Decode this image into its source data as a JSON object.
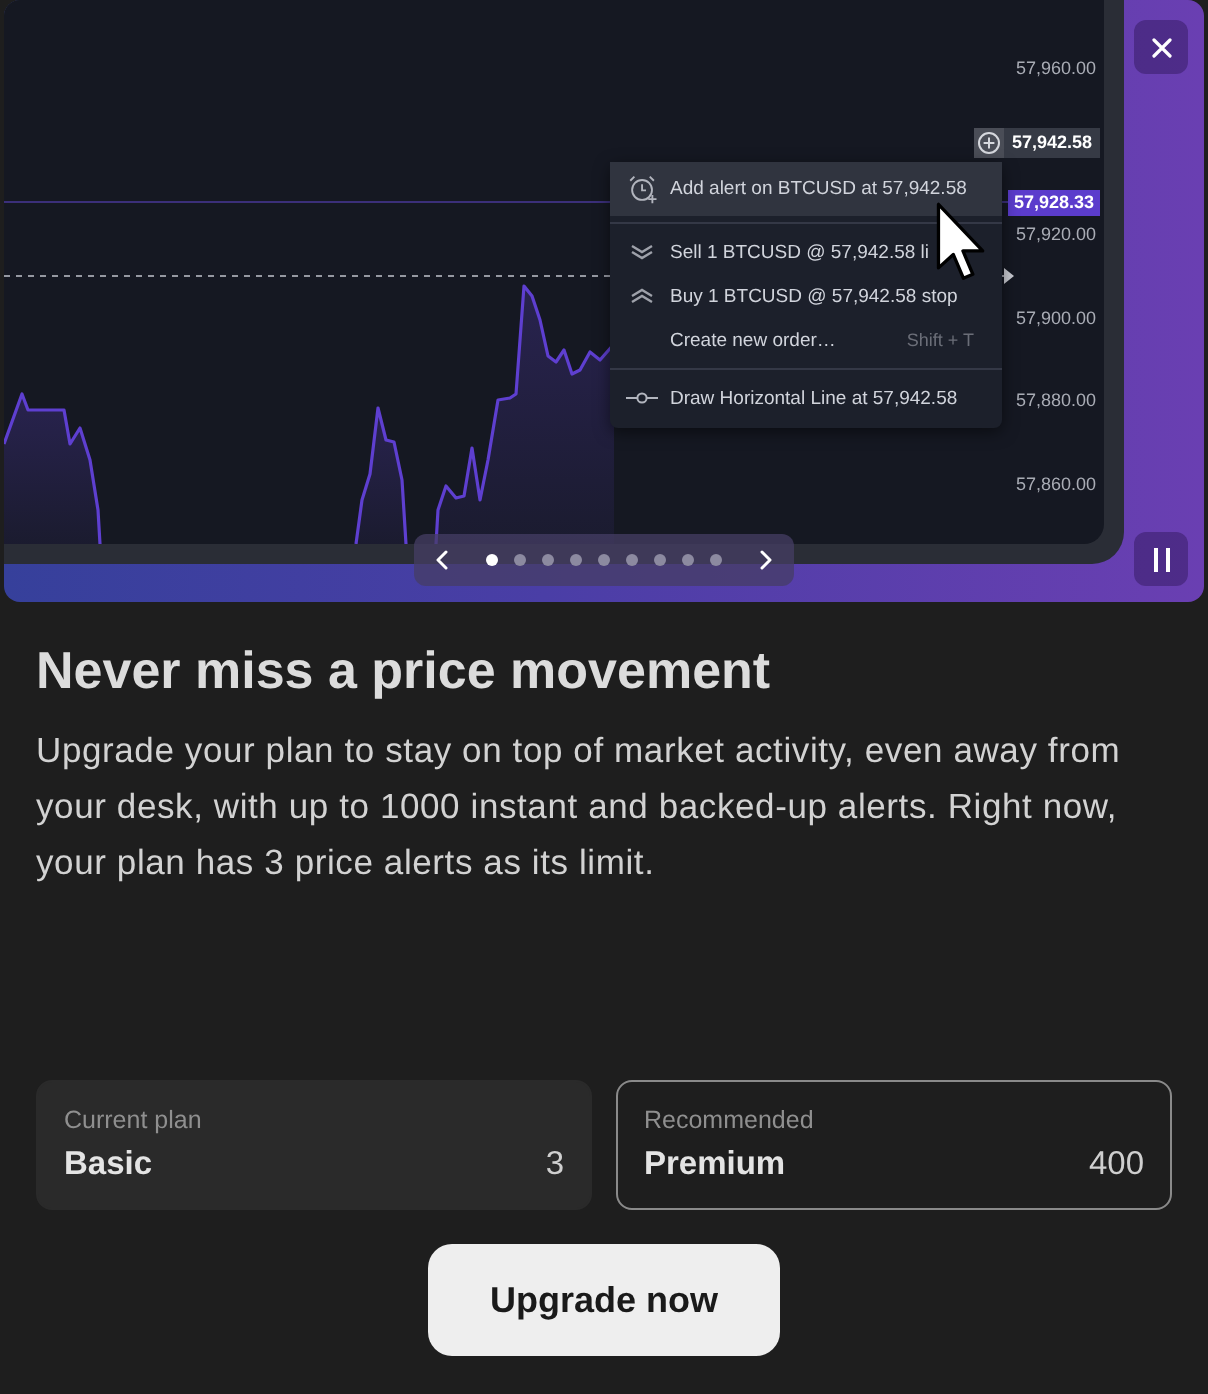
{
  "banner": {
    "chart": {
      "price_scale": [
        {
          "kind": "tick",
          "label": "57,960.00"
        },
        {
          "kind": "crosshair",
          "label": "57,942.58"
        },
        {
          "kind": "last_price",
          "label": "57,928.33"
        },
        {
          "kind": "tick",
          "label": "57,920.00"
        },
        {
          "kind": "tick",
          "label": "57,900.00"
        },
        {
          "kind": "tick",
          "label": "57,880.00"
        },
        {
          "kind": "tick",
          "label": "57,860.00"
        }
      ],
      "context_menu": [
        [
          {
            "kind": "alert",
            "label": "Add alert on BTCUSD at 57,942.58",
            "selected": true
          }
        ],
        [
          {
            "kind": "sell",
            "label": "Sell 1 BTCUSD @ 57,942.58 li",
            "selected": false
          },
          {
            "kind": "buy",
            "label": "Buy 1 BTCUSD @ 57,942.58 stop",
            "selected": false
          },
          {
            "kind": "order",
            "label": "Create new order…",
            "shortcut": "Shift + T",
            "selected": false
          }
        ],
        [
          {
            "kind": "line",
            "label": "Draw Horizontal Line at 57,942.58",
            "selected": false
          }
        ]
      ]
    },
    "pagination": [
      {
        "selected": true
      },
      {
        "selected": false
      },
      {
        "selected": false
      },
      {
        "selected": false
      },
      {
        "selected": false
      },
      {
        "selected": false
      },
      {
        "selected": false
      },
      {
        "selected": false
      },
      {
        "selected": false
      }
    ],
    "playing": true
  },
  "title": "Never miss a price movement",
  "description": "Upgrade your plan to stay on top of market activity, even away from your desk, with up to 1000 instant and backed-up alerts. Right now, your plan has 3 price alerts as its limit.",
  "plans": [
    {
      "kind": "current",
      "label": "Current plan",
      "name": "Basic",
      "alerts": "3"
    },
    {
      "kind": "recommended",
      "label": "Recommended",
      "name": "Premium",
      "alerts": "400"
    }
  ],
  "upgrade_button": "Upgrade now"
}
